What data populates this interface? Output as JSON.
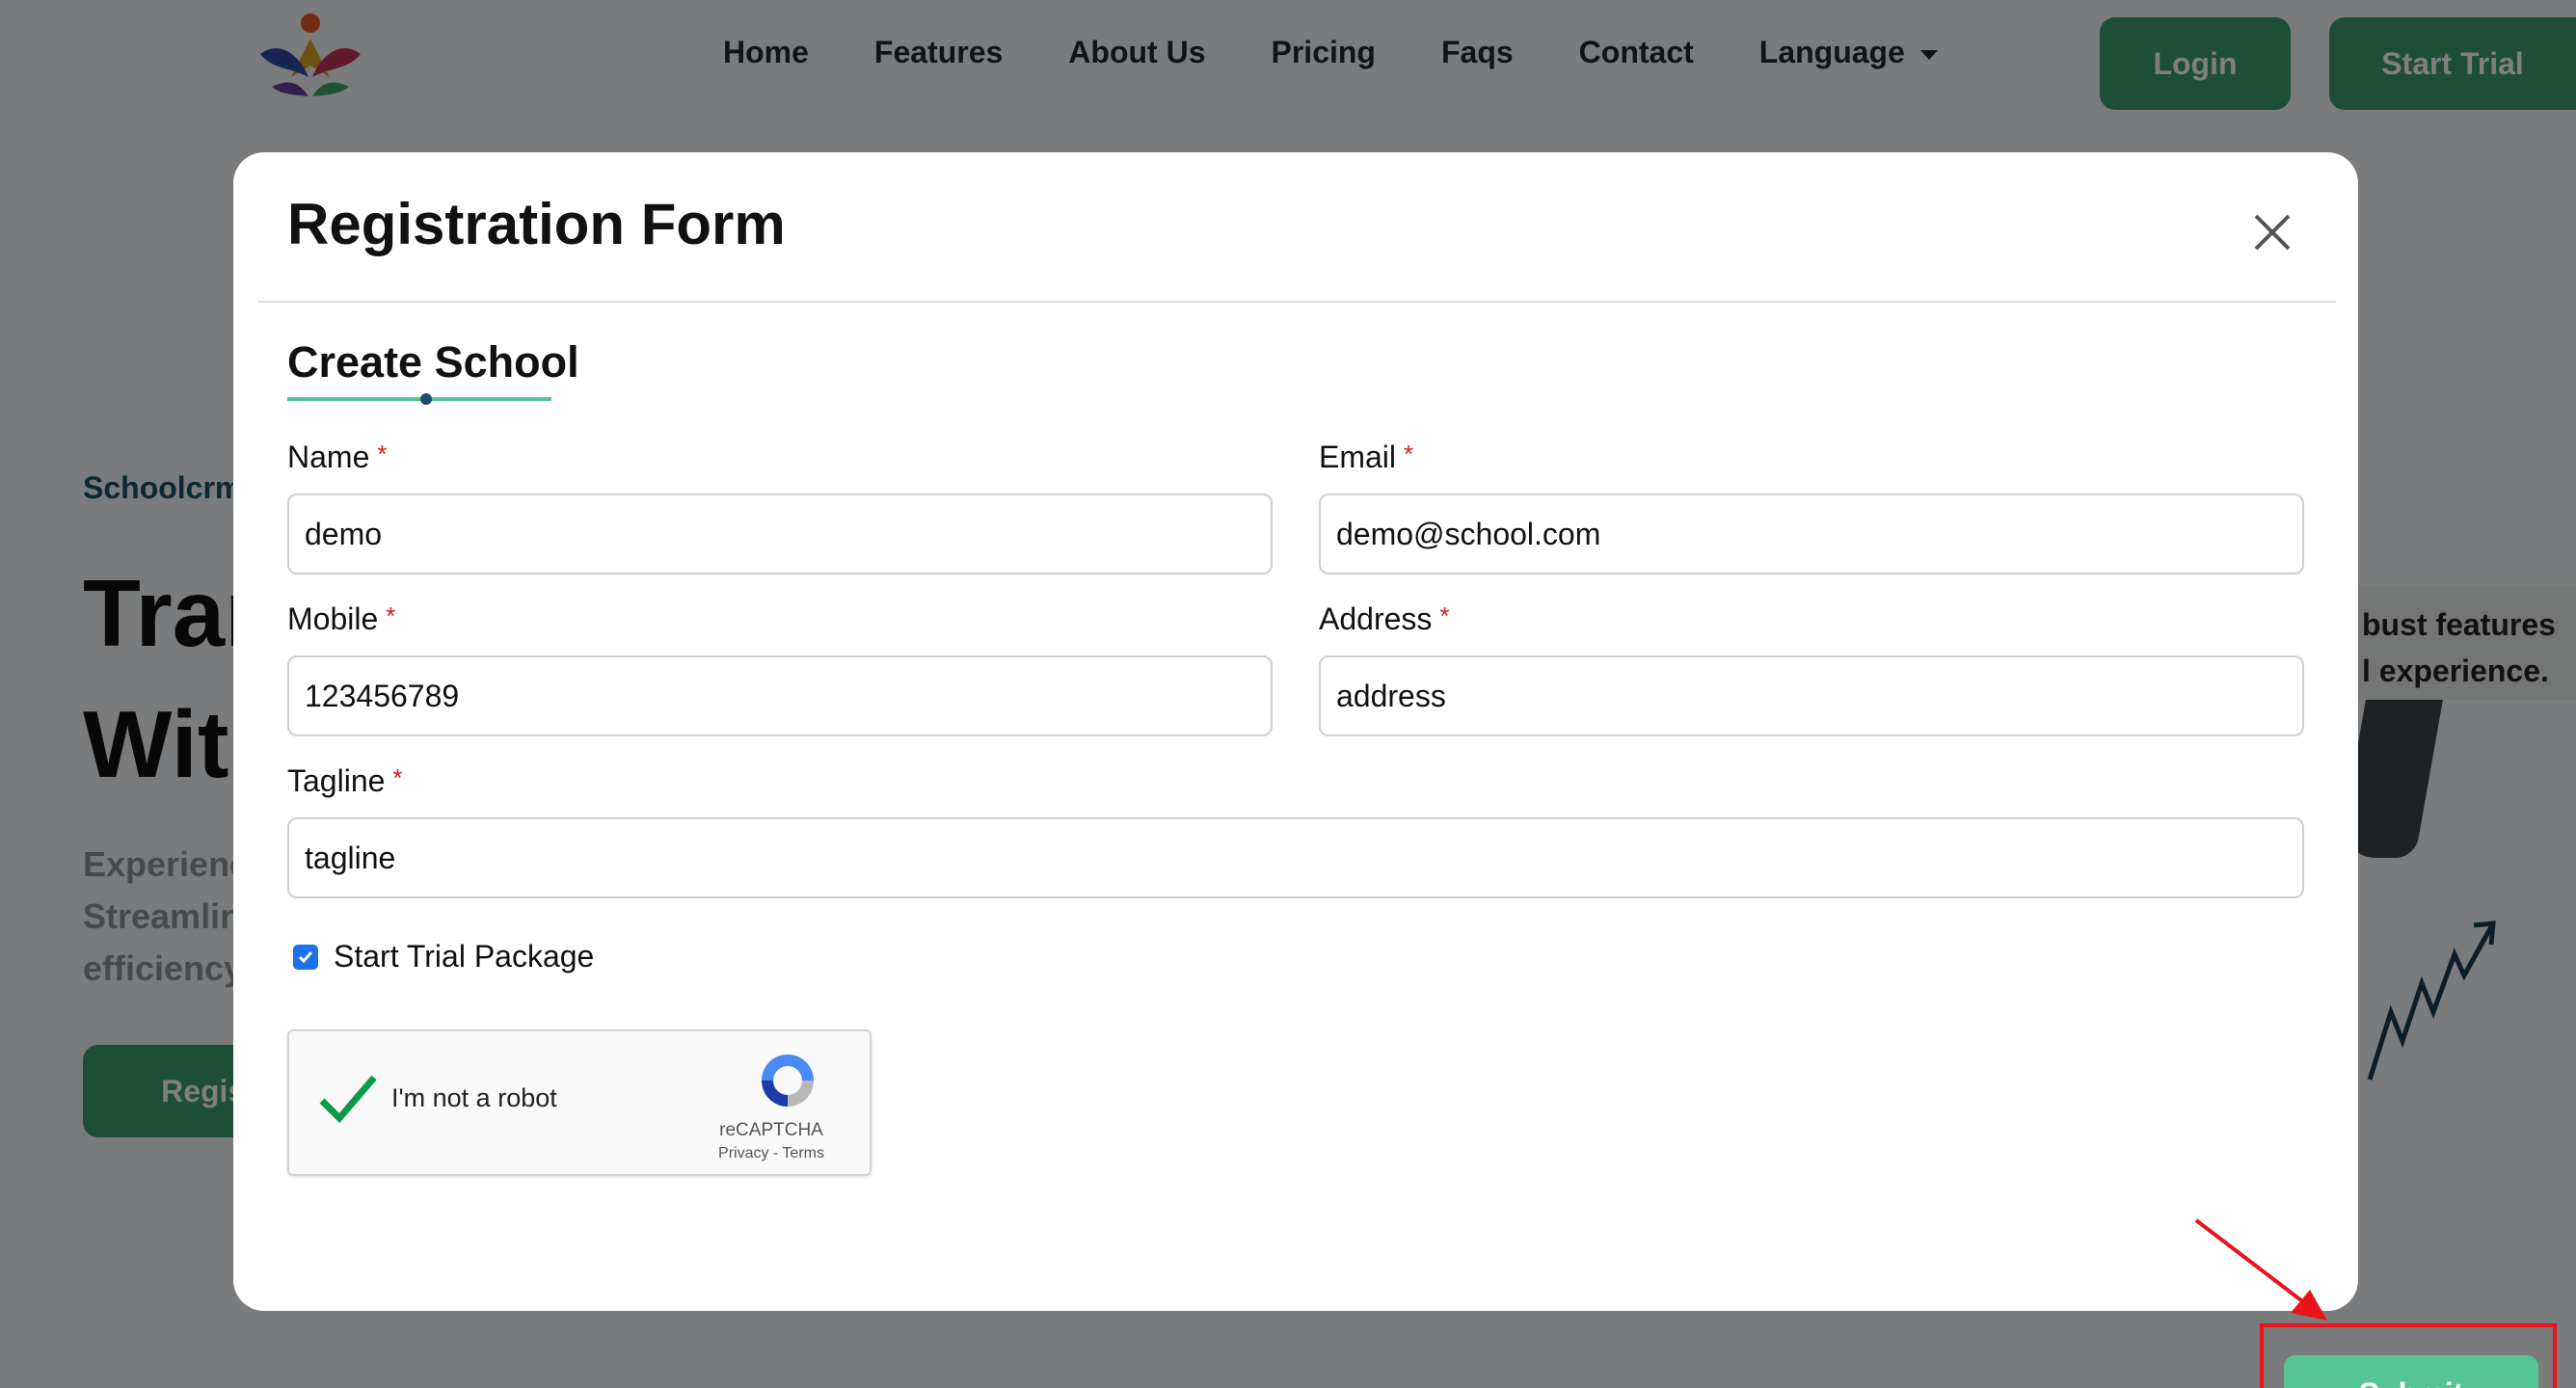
{
  "nav": {
    "links": [
      "Home",
      "Features",
      "About Us",
      "Pricing",
      "Faqs",
      "Contact",
      "Language"
    ],
    "login_label": "Login",
    "start_trial_label": "Start Trial"
  },
  "hero": {
    "tag": "Schoolcrm",
    "title_line1": "Trar",
    "title_line2": "Wit",
    "description": "Experienc\nStreamlin\nefficiency",
    "button_label": "Regist",
    "feature_card": "bust features\nl experience."
  },
  "modal": {
    "title": "Registration Form",
    "section_title": "Create School",
    "fields": {
      "name": {
        "label": "Name",
        "value": "demo"
      },
      "email": {
        "label": "Email",
        "value": "demo@school.com"
      },
      "mobile": {
        "label": "Mobile",
        "value": "123456789"
      },
      "address": {
        "label": "Address",
        "value": "address"
      },
      "tagline": {
        "label": "Tagline",
        "value": "tagline"
      }
    },
    "required_mark": "*",
    "trial_checkbox": {
      "label": "Start Trial Package",
      "checked": true
    },
    "recaptcha": {
      "label": "I'm not a robot",
      "brand": "reCAPTCHA",
      "links": "Privacy - Terms",
      "verified": true
    },
    "submit_label": "Submit"
  },
  "colors": {
    "brand_green": "#3c9b70",
    "submit_green": "#56c595",
    "annotation_red": "#e8131b",
    "checkbox_blue": "#1a73e8"
  }
}
